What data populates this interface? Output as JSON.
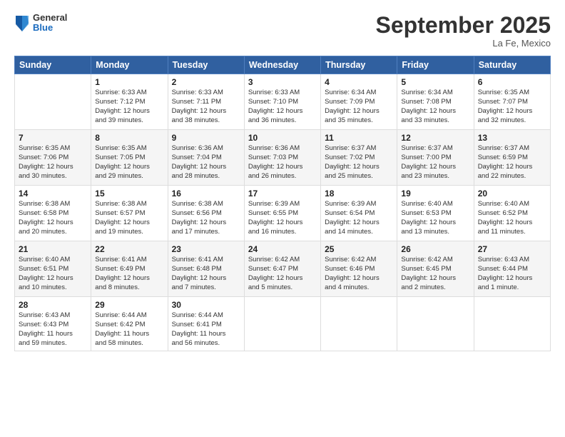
{
  "header": {
    "logo_general": "General",
    "logo_blue": "Blue",
    "month_title": "September 2025",
    "location": "La Fe, Mexico"
  },
  "days_of_week": [
    "Sunday",
    "Monday",
    "Tuesday",
    "Wednesday",
    "Thursday",
    "Friday",
    "Saturday"
  ],
  "weeks": [
    [
      {
        "num": "",
        "info": ""
      },
      {
        "num": "1",
        "info": "Sunrise: 6:33 AM\nSunset: 7:12 PM\nDaylight: 12 hours\nand 39 minutes."
      },
      {
        "num": "2",
        "info": "Sunrise: 6:33 AM\nSunset: 7:11 PM\nDaylight: 12 hours\nand 38 minutes."
      },
      {
        "num": "3",
        "info": "Sunrise: 6:33 AM\nSunset: 7:10 PM\nDaylight: 12 hours\nand 36 minutes."
      },
      {
        "num": "4",
        "info": "Sunrise: 6:34 AM\nSunset: 7:09 PM\nDaylight: 12 hours\nand 35 minutes."
      },
      {
        "num": "5",
        "info": "Sunrise: 6:34 AM\nSunset: 7:08 PM\nDaylight: 12 hours\nand 33 minutes."
      },
      {
        "num": "6",
        "info": "Sunrise: 6:35 AM\nSunset: 7:07 PM\nDaylight: 12 hours\nand 32 minutes."
      }
    ],
    [
      {
        "num": "7",
        "info": "Sunrise: 6:35 AM\nSunset: 7:06 PM\nDaylight: 12 hours\nand 30 minutes."
      },
      {
        "num": "8",
        "info": "Sunrise: 6:35 AM\nSunset: 7:05 PM\nDaylight: 12 hours\nand 29 minutes."
      },
      {
        "num": "9",
        "info": "Sunrise: 6:36 AM\nSunset: 7:04 PM\nDaylight: 12 hours\nand 28 minutes."
      },
      {
        "num": "10",
        "info": "Sunrise: 6:36 AM\nSunset: 7:03 PM\nDaylight: 12 hours\nand 26 minutes."
      },
      {
        "num": "11",
        "info": "Sunrise: 6:37 AM\nSunset: 7:02 PM\nDaylight: 12 hours\nand 25 minutes."
      },
      {
        "num": "12",
        "info": "Sunrise: 6:37 AM\nSunset: 7:00 PM\nDaylight: 12 hours\nand 23 minutes."
      },
      {
        "num": "13",
        "info": "Sunrise: 6:37 AM\nSunset: 6:59 PM\nDaylight: 12 hours\nand 22 minutes."
      }
    ],
    [
      {
        "num": "14",
        "info": "Sunrise: 6:38 AM\nSunset: 6:58 PM\nDaylight: 12 hours\nand 20 minutes."
      },
      {
        "num": "15",
        "info": "Sunrise: 6:38 AM\nSunset: 6:57 PM\nDaylight: 12 hours\nand 19 minutes."
      },
      {
        "num": "16",
        "info": "Sunrise: 6:38 AM\nSunset: 6:56 PM\nDaylight: 12 hours\nand 17 minutes."
      },
      {
        "num": "17",
        "info": "Sunrise: 6:39 AM\nSunset: 6:55 PM\nDaylight: 12 hours\nand 16 minutes."
      },
      {
        "num": "18",
        "info": "Sunrise: 6:39 AM\nSunset: 6:54 PM\nDaylight: 12 hours\nand 14 minutes."
      },
      {
        "num": "19",
        "info": "Sunrise: 6:40 AM\nSunset: 6:53 PM\nDaylight: 12 hours\nand 13 minutes."
      },
      {
        "num": "20",
        "info": "Sunrise: 6:40 AM\nSunset: 6:52 PM\nDaylight: 12 hours\nand 11 minutes."
      }
    ],
    [
      {
        "num": "21",
        "info": "Sunrise: 6:40 AM\nSunset: 6:51 PM\nDaylight: 12 hours\nand 10 minutes."
      },
      {
        "num": "22",
        "info": "Sunrise: 6:41 AM\nSunset: 6:49 PM\nDaylight: 12 hours\nand 8 minutes."
      },
      {
        "num": "23",
        "info": "Sunrise: 6:41 AM\nSunset: 6:48 PM\nDaylight: 12 hours\nand 7 minutes."
      },
      {
        "num": "24",
        "info": "Sunrise: 6:42 AM\nSunset: 6:47 PM\nDaylight: 12 hours\nand 5 minutes."
      },
      {
        "num": "25",
        "info": "Sunrise: 6:42 AM\nSunset: 6:46 PM\nDaylight: 12 hours\nand 4 minutes."
      },
      {
        "num": "26",
        "info": "Sunrise: 6:42 AM\nSunset: 6:45 PM\nDaylight: 12 hours\nand 2 minutes."
      },
      {
        "num": "27",
        "info": "Sunrise: 6:43 AM\nSunset: 6:44 PM\nDaylight: 12 hours\nand 1 minute."
      }
    ],
    [
      {
        "num": "28",
        "info": "Sunrise: 6:43 AM\nSunset: 6:43 PM\nDaylight: 11 hours\nand 59 minutes."
      },
      {
        "num": "29",
        "info": "Sunrise: 6:44 AM\nSunset: 6:42 PM\nDaylight: 11 hours\nand 58 minutes."
      },
      {
        "num": "30",
        "info": "Sunrise: 6:44 AM\nSunset: 6:41 PM\nDaylight: 11 hours\nand 56 minutes."
      },
      {
        "num": "",
        "info": ""
      },
      {
        "num": "",
        "info": ""
      },
      {
        "num": "",
        "info": ""
      },
      {
        "num": "",
        "info": ""
      }
    ]
  ]
}
